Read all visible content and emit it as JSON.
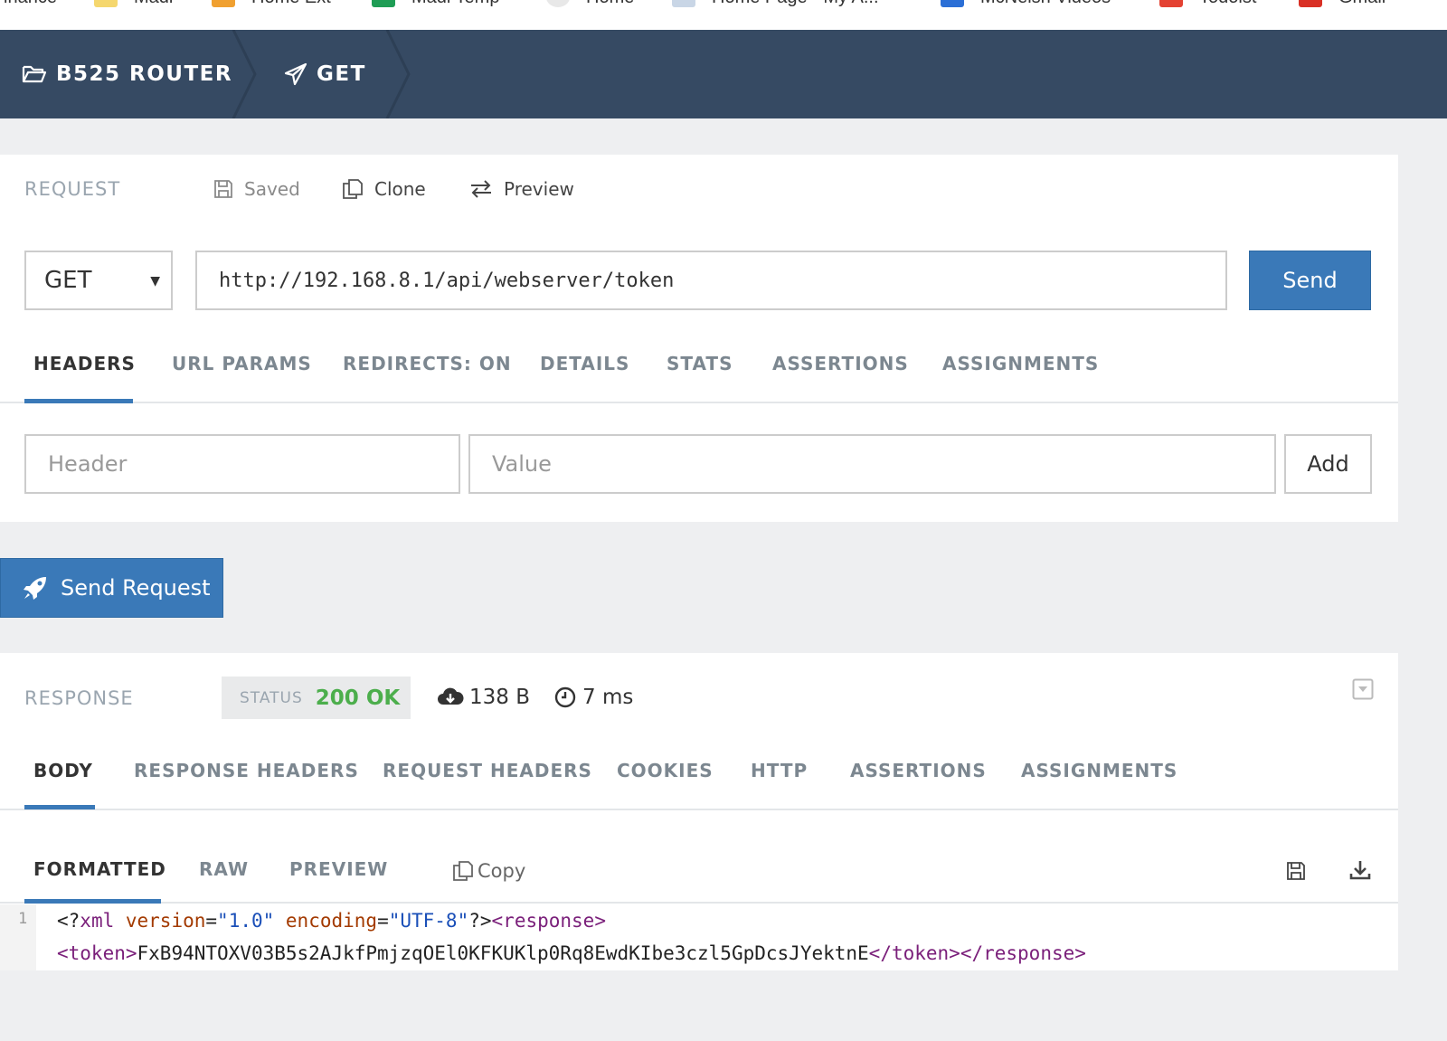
{
  "bookmarks": [
    {
      "label": "inance",
      "color": ""
    },
    {
      "label": "Madi",
      "color": "#f5d76e"
    },
    {
      "label": "Home Ext",
      "color": "#f0a030"
    },
    {
      "label": "Madi Temp",
      "color": "#1f9d55"
    },
    {
      "label": "Home",
      "color": "#e8e8e8"
    },
    {
      "label": "Home Page - My A...",
      "color": "#c9d6e6"
    },
    {
      "label": "McNeish Videos",
      "color": "#2b6fd6"
    },
    {
      "label": "Todoist",
      "color": "#e44232"
    },
    {
      "label": "Gmail",
      "color": "#d93025"
    }
  ],
  "breadcrumb": {
    "project": "B525 ROUTER",
    "request": "GET"
  },
  "request": {
    "section_label": "REQUEST",
    "saved_label": "Saved",
    "clone_label": "Clone",
    "preview_label": "Preview",
    "method": "GET",
    "url": "http://192.168.8.1/api/webserver/token",
    "send_label": "Send",
    "tabs": [
      "HEADERS",
      "URL PARAMS",
      "REDIRECTS: ON",
      "DETAILS",
      "STATS",
      "ASSERTIONS",
      "ASSIGNMENTS"
    ],
    "header_placeholder": "Header",
    "value_placeholder": "Value",
    "add_label": "Add"
  },
  "send_request_label": "Send Request",
  "response": {
    "section_label": "RESPONSE",
    "status_label": "STATUS",
    "status_value": "200 OK",
    "size": "138 B",
    "time": "7 ms",
    "tabs": [
      "BODY",
      "RESPONSE HEADERS",
      "REQUEST HEADERS",
      "COOKIES",
      "HTTP",
      "ASSERTIONS",
      "ASSIGNMENTS"
    ],
    "body_tabs": [
      "FORMATTED",
      "RAW",
      "PREVIEW"
    ],
    "copy_label": "Copy",
    "line_number": "1",
    "code": {
      "l1_open": "<?",
      "l1_xml": "xml",
      "l1_version_attr": " version",
      "l1_eq1": "=",
      "l1_version_val": "\"1.0\"",
      "l1_encoding_attr": " encoding",
      "l1_eq2": "=",
      "l1_encoding_val": "\"UTF-8\"",
      "l1_close": "?>",
      "l1_response_open": "<response>",
      "l2_token_open": "<token>",
      "l2_token_value": "FxB94NTOXV03B5s2AJkfPmjzqOEl0KFKUKlp0Rq8EwdKIbe3czl5GpDcsJYektnE",
      "l2_token_close": "</token>",
      "l2_response_close": "</response>"
    }
  },
  "colors": {
    "header_bg": "#364a63",
    "accent": "#3a79b8",
    "status_ok": "#4cae4c"
  }
}
